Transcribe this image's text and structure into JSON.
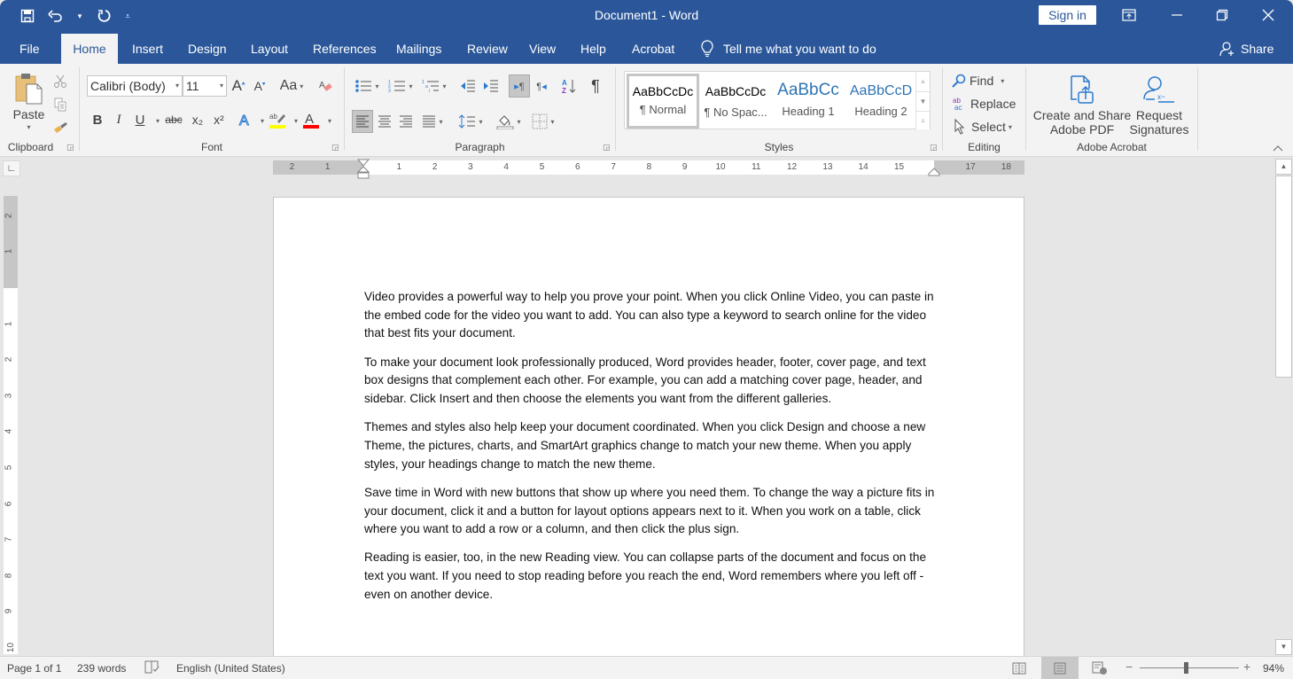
{
  "app": {
    "document_title": "Document1  -  Word",
    "sign_in": "Sign in",
    "brand_color": "#2b579a"
  },
  "qat": {
    "save": "save-icon",
    "undo": "undo-icon",
    "redo": "redo-icon",
    "customize": "customize-qat-icon"
  },
  "tabs": [
    {
      "label": "File"
    },
    {
      "label": "Home",
      "active": true
    },
    {
      "label": "Insert"
    },
    {
      "label": "Design"
    },
    {
      "label": "Layout"
    },
    {
      "label": "References"
    },
    {
      "label": "Mailings"
    },
    {
      "label": "Review"
    },
    {
      "label": "View"
    },
    {
      "label": "Help"
    },
    {
      "label": "Acrobat"
    }
  ],
  "tell_me": "Tell me what you want to do",
  "share": "Share",
  "ribbon": {
    "clipboard": {
      "label": "Clipboard",
      "paste": "Paste"
    },
    "font": {
      "label": "Font",
      "font_name": "Calibri (Body)",
      "font_size": "11",
      "change_case": "Aa",
      "bold": "B",
      "italic": "I",
      "underline": "U",
      "strikethrough": "abc",
      "subscript": "x₂",
      "superscript": "x²",
      "highlight_color": "#ffff00",
      "font_color": "#ff0000"
    },
    "paragraph": {
      "label": "Paragraph"
    },
    "styles": {
      "label": "Styles",
      "items": [
        {
          "preview": "AaBbCcDc",
          "name": "¶ Normal",
          "selected": true
        },
        {
          "preview": "AaBbCcDc",
          "name": "¶ No Spac..."
        },
        {
          "preview": "AaBbCc",
          "name": "Heading 1"
        },
        {
          "preview": "AaBbCcD",
          "name": "Heading 2"
        }
      ]
    },
    "editing": {
      "label": "Editing",
      "find": "Find",
      "replace": "Replace",
      "select": "Select"
    },
    "acrobat": {
      "label": "Adobe Acrobat",
      "create_line1": "Create and Share",
      "create_line2": "Adobe PDF",
      "request_line1": "Request",
      "request_line2": "Signatures"
    }
  },
  "ruler": {
    "horizontal_labels": [
      "2",
      "1",
      "1",
      "2",
      "3",
      "4",
      "5",
      "6",
      "7",
      "8",
      "9",
      "10",
      "11",
      "12",
      "13",
      "14",
      "15",
      "17",
      "18"
    ],
    "vertical_labels": [
      "2",
      "1",
      "1",
      "2",
      "3",
      "4",
      "5",
      "6",
      "7",
      "8",
      "9",
      "10"
    ]
  },
  "document": {
    "paragraphs": [
      "Video provides a powerful way to help you prove your point. When you click Online Video, you can paste in the embed code for the video you want to add. You can also type a keyword to search online for the video that best fits your document.",
      "To make your document look professionally produced, Word provides header, footer, cover page, and text box designs that complement each other. For example, you can add a matching cover page, header, and sidebar. Click Insert and then choose the elements you want from the different galleries.",
      "Themes and styles also help keep your document coordinated. When you click Design and choose a new Theme, the pictures, charts, and SmartArt graphics change to match your new theme. When you apply styles, your headings change to match the new theme.",
      "Save time in Word with new buttons that show up where you need them. To change the way a picture fits in your document, click it and a button for layout options appears next to it. When you work on a table, click where you want to add a row or a column, and then click the plus sign.",
      "Reading is easier, too, in the new Reading view. You can collapse parts of the document and focus on the text you want. If you need to stop reading before you reach the end, Word remembers where you left off - even on another device."
    ]
  },
  "status": {
    "page": "Page 1 of 1",
    "words": "239 words",
    "language": "English (United States)",
    "zoom": "94%",
    "zoom_percent": 94,
    "active_view": "print-layout"
  }
}
